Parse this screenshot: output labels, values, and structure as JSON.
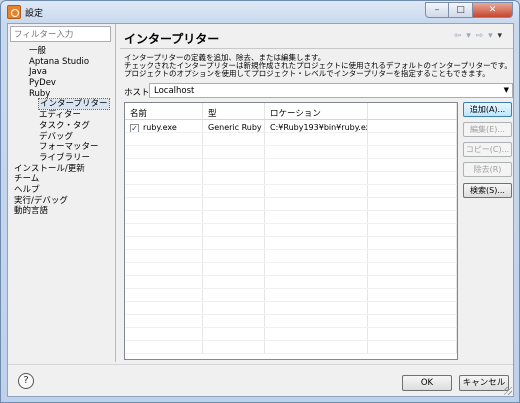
{
  "window": {
    "title": "設定",
    "controls": {
      "minimize": "–",
      "maximize": "□",
      "close": "✕"
    }
  },
  "filter": {
    "placeholder": "フィルター入力"
  },
  "tree": {
    "items": [
      {
        "label": "一般",
        "level": 1
      },
      {
        "label": "Aptana Studio",
        "level": 1
      },
      {
        "label": "Java",
        "level": 1
      },
      {
        "label": "PyDev",
        "level": 1
      },
      {
        "label": "Ruby",
        "level": 1
      },
      {
        "label": "インタープリター",
        "level": 2,
        "selected": true
      },
      {
        "label": "エディター",
        "level": 2
      },
      {
        "label": "タスク・タグ",
        "level": 2
      },
      {
        "label": "デバッグ",
        "level": 2
      },
      {
        "label": "フォーマッター",
        "level": 2
      },
      {
        "label": "ライブラリー",
        "level": 2
      },
      {
        "label": "インストール/更新",
        "level": 0
      },
      {
        "label": "チーム",
        "level": 0
      },
      {
        "label": "ヘルプ",
        "level": 0
      },
      {
        "label": "実行/デバッグ",
        "level": 0
      },
      {
        "label": "動的言語",
        "level": 0
      }
    ]
  },
  "page": {
    "title": "インタープリター",
    "nav": {
      "back": "⇦",
      "back_menu": "▾",
      "forward": "⇨",
      "forward_menu": "▾",
      "view_menu": "▾"
    },
    "description": [
      "インタープリターの定義を追加、除去、または編集します。",
      "チェックされたインタープリターは新規作成されたプロジェクトに使用されるデフォルトのインタープリターです。",
      "プロジェクトのオプションを使用してプロジェクト・レベルでインタープリターを指定することもできます。"
    ],
    "host": {
      "label": "ホスト:",
      "value": "Localhost",
      "arrow": "▼"
    }
  },
  "table": {
    "columns": [
      "名前",
      "型",
      "ロケーション",
      ""
    ],
    "rows": [
      {
        "checked": true,
        "check_mark": "✓",
        "name": "ruby.exe",
        "type": "Generic Ruby",
        "location": "C:¥Ruby193¥bin¥ruby.exe",
        "extra": ""
      }
    ]
  },
  "buttons": {
    "add": "追加(A)...",
    "edit": "編集(E)...",
    "copy": "コピー(C)...",
    "remove": "除去(R)",
    "search": "検索(S)..."
  },
  "footer": {
    "help": "?",
    "ok": "OK",
    "cancel": "キャンセル"
  }
}
